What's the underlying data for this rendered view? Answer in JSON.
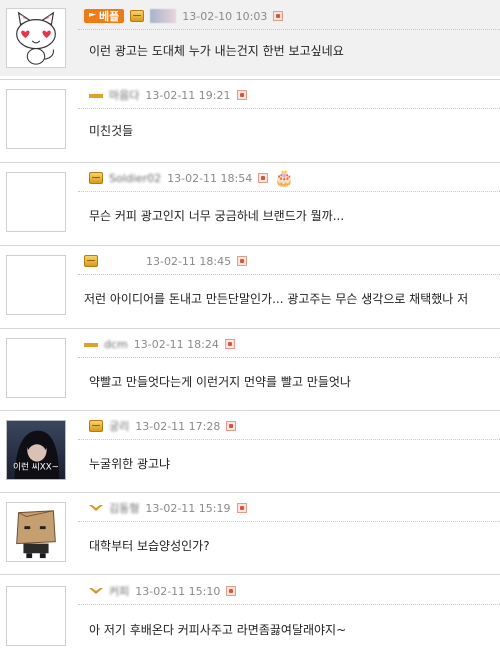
{
  "comments": [
    {
      "badge": "베플",
      "date": "13-02-10 10:03",
      "text": "이런 광고는 도대체 누가 내는건지 한번 보고싶네요"
    },
    {
      "nick": "마음다",
      "date": "13-02-11 19:21",
      "text": "미친것들"
    },
    {
      "nick": "Soldier02",
      "date": "13-02-11 18:54",
      "text": "무슨 커피 광고인지 너무 궁금하네 브랜드가 뭘까..."
    },
    {
      "nick": "",
      "date": "13-02-11 18:45",
      "text": "저런 아이디어를 돈내고 만든단말인가... 광고주는 무슨 생각으로 채택했나 저"
    },
    {
      "nick": "dcm",
      "date": "13-02-11 18:24",
      "text": "약빨고 만들엇다는게 이런거지 먼약를 빨고 만들엇나"
    },
    {
      "nick": "궁리",
      "date": "13-02-11 17:28",
      "text": "누굴위한 광고냐",
      "avatar_text": "이런 씨XX~"
    },
    {
      "nick": "김동형",
      "date": "13-02-11 15:19",
      "text": "대학부터 보습양성인가?"
    },
    {
      "nick": "커피",
      "date": "13-02-11 15:10",
      "text": "아 저기 후배온다 커피사주고 라면좀끓여달래야지~"
    }
  ],
  "colors": {
    "best": "#f07b12",
    "date": "#8a8a8a"
  }
}
